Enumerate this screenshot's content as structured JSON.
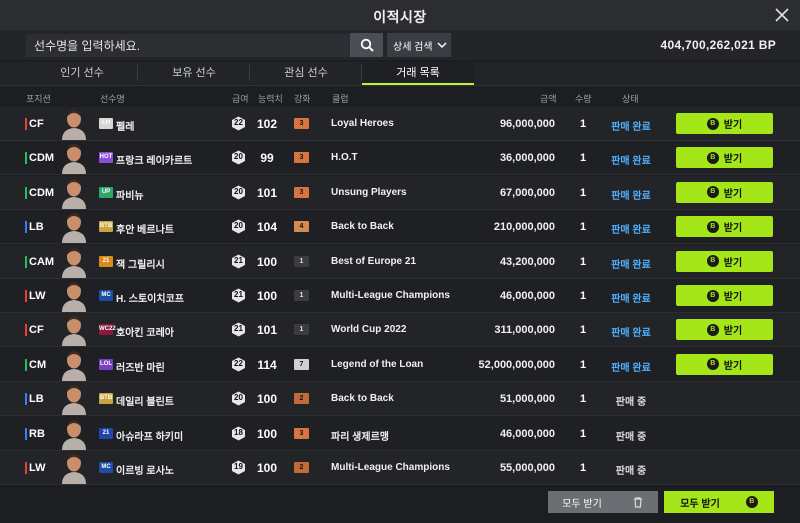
{
  "window": {
    "title": "이적시장"
  },
  "search": {
    "placeholder": "선수명을 입력하세요.",
    "advanced_label": "상세 검색"
  },
  "balance": {
    "value": "404,700,262,021 BP"
  },
  "tabs": [
    {
      "label": "인기 선수",
      "active": false
    },
    {
      "label": "보유 선수",
      "active": false
    },
    {
      "label": "관심 선수",
      "active": false
    },
    {
      "label": "거래 목록",
      "active": true
    }
  ],
  "columns": {
    "position": "포지션",
    "player": "선수명",
    "salary": "급여",
    "ovr": "능력치",
    "enhance": "강화",
    "club": "클럽",
    "price": "금액",
    "qty": "수량",
    "status": "상태"
  },
  "colors": {
    "accent": "#a5e619",
    "status_done": "#4fb0ff",
    "pos_fw": "#e8403a",
    "pos_mf": "#22c05b",
    "pos_df": "#3c7cff"
  },
  "rows": [
    {
      "pos": "CF",
      "pos_color": "#e8403a",
      "season": "LH",
      "season_color": "#d6d6d6",
      "name": "펠레",
      "salary": "22",
      "ovr": "102",
      "enh": "3",
      "club": "Loyal Heroes",
      "price": "96,000,000",
      "qty": "1",
      "status": "판매 완료",
      "done": true,
      "button": "받기"
    },
    {
      "pos": "CDM",
      "pos_color": "#22c05b",
      "season": "HOT",
      "season_color": "#8a4fd8",
      "name": "프랑크 레이카르트",
      "salary": "20",
      "ovr": "99",
      "enh": "3",
      "club": "H.O.T",
      "price": "36,000,000",
      "qty": "1",
      "status": "판매 완료",
      "done": true,
      "button": "받기"
    },
    {
      "pos": "CDM",
      "pos_color": "#22c05b",
      "season": "UP",
      "season_color": "#2fa66a",
      "name": "파비뉴",
      "salary": "20",
      "ovr": "101",
      "enh": "3",
      "club": "Unsung Players",
      "price": "67,000,000",
      "qty": "1",
      "status": "판매 완료",
      "done": true,
      "button": "받기"
    },
    {
      "pos": "LB",
      "pos_color": "#3c7cff",
      "season": "BTB",
      "season_color": "#c7a53a",
      "name": "후안 베르나트",
      "salary": "20",
      "ovr": "104",
      "enh": "4",
      "club": "Back to Back",
      "price": "210,000,000",
      "qty": "1",
      "status": "판매 완료",
      "done": true,
      "button": "받기"
    },
    {
      "pos": "CAM",
      "pos_color": "#22c05b",
      "season": "21",
      "season_color": "#d98c1a",
      "name": "잭 그릴리시",
      "salary": "21",
      "ovr": "100",
      "enh": "1",
      "club": "Best of Europe 21",
      "price": "43,200,000",
      "qty": "1",
      "status": "판매 완료",
      "done": true,
      "button": "받기"
    },
    {
      "pos": "LW",
      "pos_color": "#e8403a",
      "season": "MC",
      "season_color": "#1e4da8",
      "name": "H. 스토이치코프",
      "salary": "21",
      "ovr": "100",
      "enh": "1",
      "club": "Multi-League Champions",
      "price": "46,000,000",
      "qty": "1",
      "status": "판매 완료",
      "done": true,
      "button": "받기"
    },
    {
      "pos": "CF",
      "pos_color": "#e8403a",
      "season": "WC22",
      "season_color": "#8b1a3a",
      "name": "호아킨 코레아",
      "salary": "21",
      "ovr": "101",
      "enh": "1",
      "club": "World Cup 2022",
      "price": "311,000,000",
      "qty": "1",
      "status": "판매 완료",
      "done": true,
      "button": "받기"
    },
    {
      "pos": "CM",
      "pos_color": "#22c05b",
      "season": "LOL",
      "season_color": "#7a3fc2",
      "name": "러즈반 마린",
      "salary": "22",
      "ovr": "114",
      "enh": "7",
      "club": "Legend of the Loan",
      "price": "52,000,000,000",
      "qty": "1",
      "status": "판매 완료",
      "done": true,
      "button": "받기"
    },
    {
      "pos": "LB",
      "pos_color": "#3c7cff",
      "season": "BTB",
      "season_color": "#c7a53a",
      "name": "데일리 블린트",
      "salary": "20",
      "ovr": "100",
      "enh": "2",
      "club": "Back to Back",
      "price": "51,000,000",
      "qty": "1",
      "status": "판매 중",
      "done": false,
      "button": ""
    },
    {
      "pos": "RB",
      "pos_color": "#3c7cff",
      "season": "21",
      "season_color": "#2345a8",
      "name": "아슈라프 하키미",
      "salary": "18",
      "ovr": "100",
      "enh": "3",
      "club": "파리 생제르맹",
      "price": "46,000,000",
      "qty": "1",
      "status": "판매 중",
      "done": false,
      "button": ""
    },
    {
      "pos": "LW",
      "pos_color": "#e8403a",
      "season": "MC",
      "season_color": "#1e4da8",
      "name": "이르빙 로사노",
      "salary": "19",
      "ovr": "100",
      "enh": "2",
      "club": "Multi-League Champions",
      "price": "55,000,000",
      "qty": "1",
      "status": "판매 중",
      "done": false,
      "button": ""
    }
  ],
  "footer": {
    "receive_all_gray": "모두 받기",
    "receive_all_green": "모두 받기"
  }
}
